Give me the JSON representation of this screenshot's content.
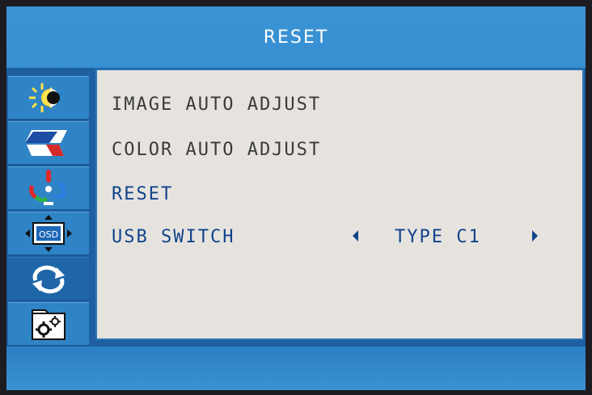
{
  "header": {
    "title": "RESET"
  },
  "sidebar": {
    "items": [
      {
        "icon": "brightness-contrast-icon"
      },
      {
        "icon": "color-settings-icon"
      },
      {
        "icon": "picture-rgb-icon"
      },
      {
        "icon": "osd-settings-icon",
        "label": "OSD"
      },
      {
        "icon": "reset-arrows-icon",
        "active": true
      },
      {
        "icon": "other-settings-gears-icon"
      }
    ]
  },
  "menu": {
    "items": [
      {
        "label": "IMAGE AUTO ADJUST"
      },
      {
        "label": "COLOR AUTO ADJUST"
      },
      {
        "label": "RESET"
      },
      {
        "label": "USB SWITCH"
      }
    ],
    "usb_switch_value": "TYPE C1"
  },
  "colors": {
    "background_blue": "#2d86c9",
    "panel": "#e6e3df",
    "text_highlight": "#10438a",
    "text_normal": "#3a3a3a"
  }
}
